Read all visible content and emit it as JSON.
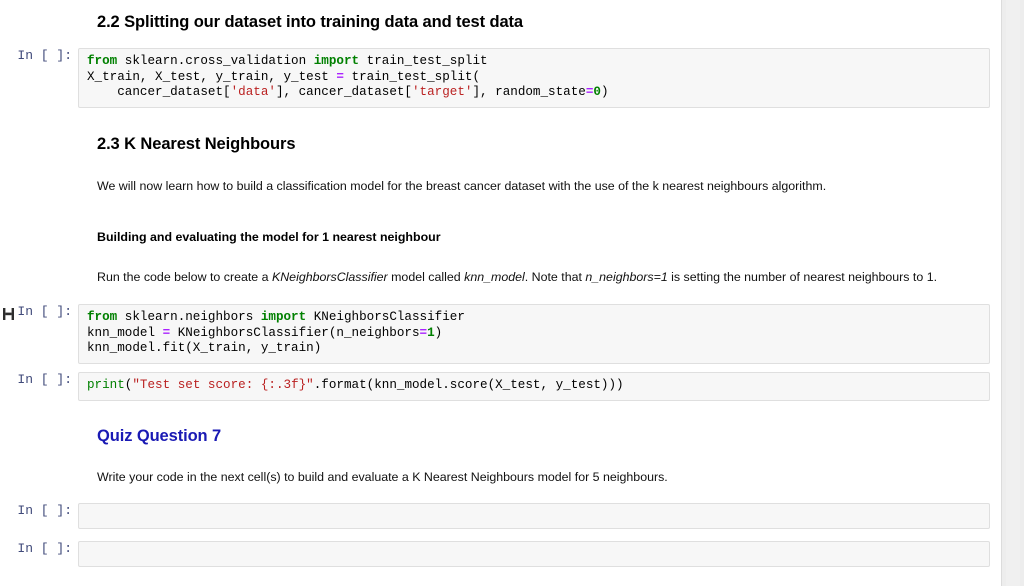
{
  "notebook": {
    "prompt_label": "In [ ]:",
    "cells": [
      {
        "id": "md-22",
        "type": "markdown",
        "heading": "2.2 Splitting our dataset into training data and test data"
      },
      {
        "id": "code-1",
        "type": "code",
        "prompt": "In [ ]:",
        "lines": [
          "from sklearn.cross_validation import train_test_split",
          "X_train, X_test, y_train, y_test = train_test_split(",
          "    cancer_dataset['data'], cancer_dataset['target'], random_state=0)"
        ]
      },
      {
        "id": "md-23",
        "type": "markdown",
        "heading": "2.3 K Nearest Neighbours"
      },
      {
        "id": "md-intro",
        "type": "markdown",
        "paragraph": "We will now learn how to build a classification model for the breast cancer dataset with the use of the k nearest neighbours algorithm."
      },
      {
        "id": "md-build",
        "type": "markdown",
        "subheading": "Building and evaluating the model for 1 nearest neighbour"
      },
      {
        "id": "md-run",
        "type": "markdown",
        "paragraph_parts": {
          "t1": "Run the code below to create a ",
          "i1": "KNeighborsClassifier",
          "t2": " model called ",
          "i2": "knn_model",
          "t3": ". Note that ",
          "i3": "n_neighbors=1",
          "t4": " is setting the number of nearest neighbours to 1."
        }
      },
      {
        "id": "code-2",
        "type": "code",
        "prompt": "In [ ]:",
        "lines": [
          "from sklearn.neighbors import KNeighborsClassifier",
          "knn_model = KNeighborsClassifier(n_neighbors=1)",
          "knn_model.fit(X_train, y_train)"
        ]
      },
      {
        "id": "code-3",
        "type": "code",
        "prompt": "In [ ]:",
        "lines": [
          "print(\"Test set score: {:.3f}\".format(knn_model.score(X_test, y_test)))"
        ]
      },
      {
        "id": "md-quiz",
        "type": "markdown",
        "heading": "Quiz Question 7"
      },
      {
        "id": "md-write",
        "type": "markdown",
        "paragraph": "Write your code in the next cell(s) to build and evaluate a K Nearest Neighbours model for 5 neighbours."
      },
      {
        "id": "code-4",
        "type": "code",
        "prompt": "In [ ]:",
        "lines": [
          ""
        ]
      },
      {
        "id": "code-5",
        "type": "code",
        "prompt": "In [ ]:",
        "lines": [
          ""
        ]
      }
    ]
  },
  "code_tokens": {
    "cell1": {
      "kw_from": "from",
      "mod1": " sklearn.cross_validation ",
      "kw_import": "import",
      "rest1": " train_test_split",
      "line2_a": "X_train, X_test, y_train, y_test ",
      "line2_op": "=",
      "line2_b": " train_test_split(",
      "line3_a": "    cancer_dataset[",
      "line3_s1": "'data'",
      "line3_b": "], cancer_dataset[",
      "line3_s2": "'target'",
      "line3_c": "], random_state",
      "line3_op": "=",
      "line3_num": "0",
      "line3_d": ")"
    },
    "cell2": {
      "kw_from": "from",
      "mod1": " sklearn.neighbors ",
      "kw_import": "import",
      "rest1": " KNeighborsClassifier",
      "line2_a": "knn_model ",
      "line2_op": "=",
      "line2_b": " KNeighborsClassifier(n_neighbors",
      "line2_op2": "=",
      "line2_num": "1",
      "line2_c": ")",
      "line3": "knn_model.fit(X_train, y_train)"
    },
    "cell3": {
      "fn": "print",
      "p1": "(",
      "str": "\"Test set score: {:.3f}\"",
      "p2": ".format(knn_model.score(X_test, y_test)))"
    }
  },
  "theme": {
    "code_background": "#f7f7f7",
    "code_border": "#dfdfdf",
    "prompt_color": "#404a7a",
    "keyword_color": "#008000",
    "string_color": "#ba2121",
    "operator_color": "#aa22ff",
    "quiz_heading_color": "#1a1ab4",
    "page_background": "#ffffff",
    "gutter_color": "#ededed"
  }
}
